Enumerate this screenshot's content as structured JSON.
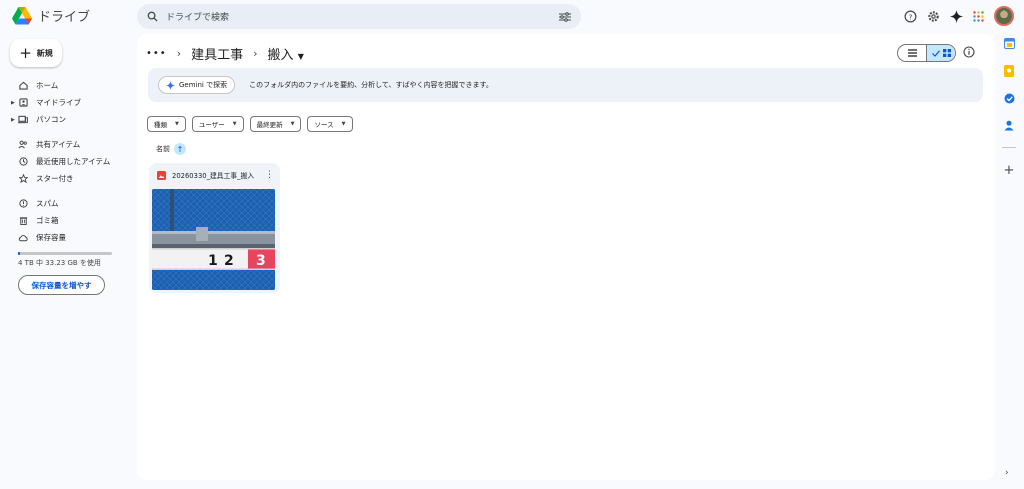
{
  "header": {
    "app_name": "ドライブ",
    "search_placeholder": "ドライブで検索"
  },
  "sidebar": {
    "new_label": "新規",
    "items": [
      {
        "label": "ホーム",
        "icon": "home-icon"
      },
      {
        "label": "マイドライブ",
        "icon": "my-drive-icon"
      },
      {
        "label": "パソコン",
        "icon": "computers-icon"
      },
      {
        "label": "共有アイテム",
        "icon": "shared-icon"
      },
      {
        "label": "最近使用したアイテム",
        "icon": "recent-icon"
      },
      {
        "label": "スター付き",
        "icon": "star-icon"
      },
      {
        "label": "スパム",
        "icon": "spam-icon"
      },
      {
        "label": "ゴミ箱",
        "icon": "trash-icon"
      },
      {
        "label": "保存容量",
        "icon": "cloud-icon"
      }
    ],
    "storage_usage": "4 TB 中 33.23 GB を使用",
    "storage_usage_fraction": 0.0081,
    "storage_button": "保存容量を増やす"
  },
  "breadcrumb": {
    "parent": "建具工事",
    "current": "搬入"
  },
  "gemini": {
    "button_label": "Gemini で探索",
    "prompt_text": "このフォルダ内のファイルを要約、分析して、すばやく内容を把握できます。"
  },
  "filters": [
    "種類",
    "ユーザー",
    "最終更新",
    "ソース"
  ],
  "sort": {
    "label": "名前"
  },
  "files": [
    {
      "name": "20260330_建具工事_搬入",
      "type": "image"
    }
  ],
  "colors": {
    "accent": "#0b57d0",
    "selected": "#c2e7ff",
    "panel": "#ffffff",
    "background": "#f8fafd"
  }
}
